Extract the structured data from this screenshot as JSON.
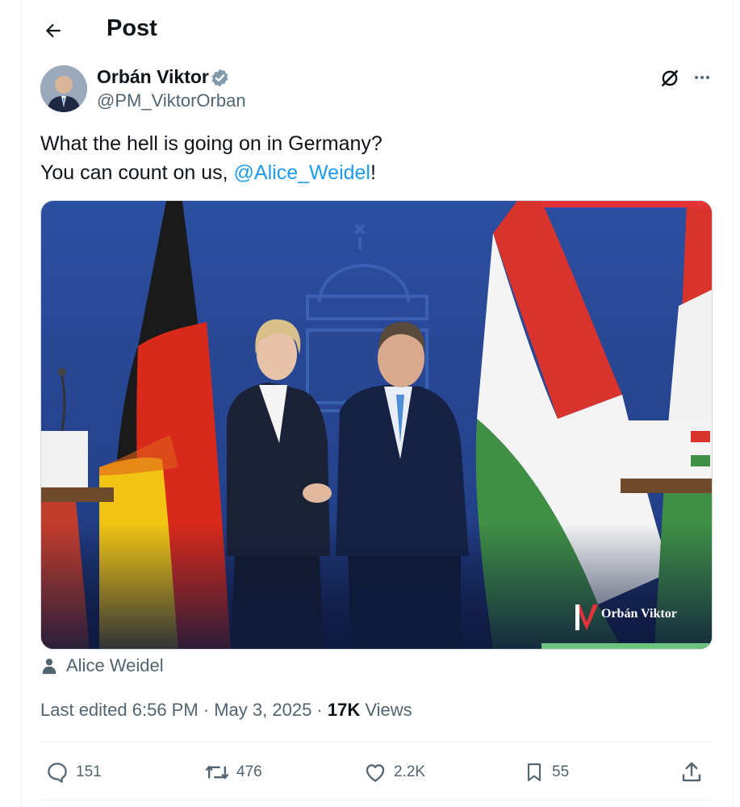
{
  "header": {
    "title": "Post"
  },
  "author": {
    "name": "Orbán Viktor",
    "handle": "@PM_ViktorOrban"
  },
  "tweet": {
    "line1": "What the hell is going on in Germany?",
    "line2_prefix": "You can count on us, ",
    "mention": "@Alice_Weidel",
    "line2_suffix": "!"
  },
  "media": {
    "watermark": "Orbán Viktor"
  },
  "tagged_user": "Alice Weidel",
  "meta": {
    "edited": "Last edited 6:56 PM · May 3, 2025 · ",
    "views_count": "17K",
    "views_label": " Views"
  },
  "actions": {
    "replies": "151",
    "reposts": "476",
    "likes": "2.2K",
    "bookmarks": "55"
  },
  "colors": {
    "accent": "#1d9bf0",
    "muted": "#536471",
    "text": "#0f1419"
  }
}
